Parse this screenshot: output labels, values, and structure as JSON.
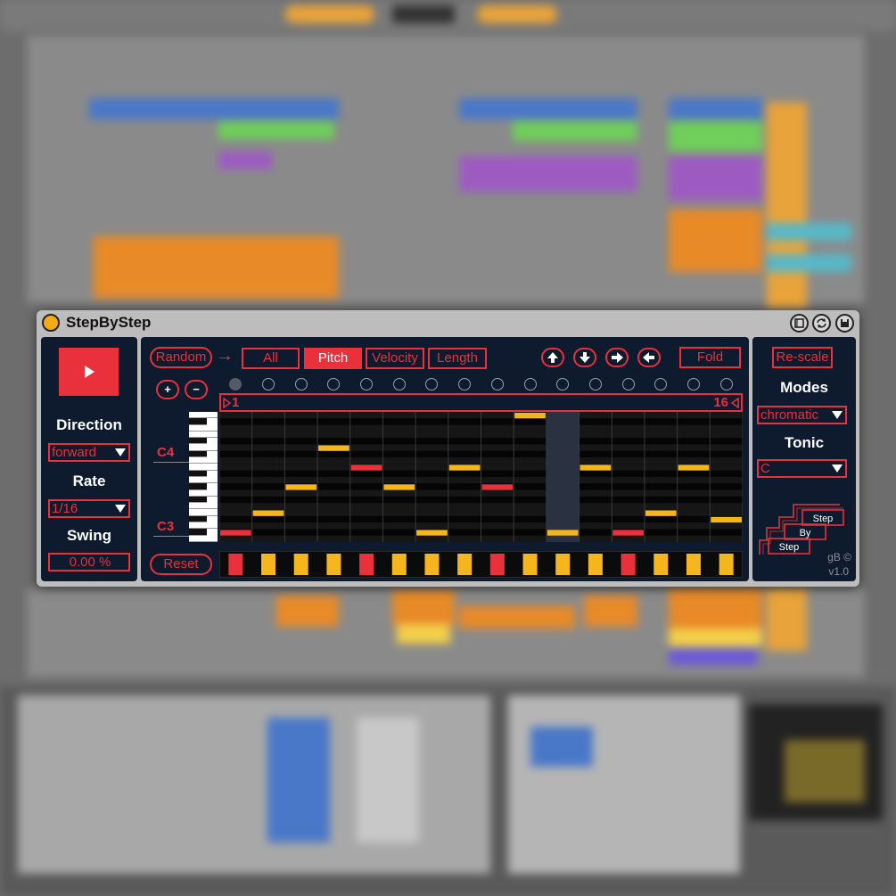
{
  "plugin": {
    "title": "StepByStep",
    "titlebar_icons": [
      "device-icon",
      "refresh-icon",
      "save-icon"
    ]
  },
  "left": {
    "play_icon": "play-icon",
    "direction_label": "Direction",
    "direction_value": "forward",
    "rate_label": "Rate",
    "rate_value": "1/16",
    "swing_label": "Swing",
    "swing_value": "0.00 %"
  },
  "main": {
    "random_label": "Random",
    "arrow": "→",
    "tabs": [
      {
        "label": "All",
        "active": false
      },
      {
        "label": "Pitch",
        "active": true
      },
      {
        "label": "Velocity",
        "active": false
      },
      {
        "label": "Length",
        "active": false
      }
    ],
    "shift_icons": [
      "arrow-up-icon",
      "arrow-down-icon",
      "arrow-right-icon",
      "arrow-left-icon"
    ],
    "fold_label": "Fold",
    "add_label": "+",
    "remove_label": "−",
    "reset_label": "Reset",
    "loop_start": "1",
    "loop_end": "16",
    "key_c4": "C4",
    "key_c3": "C3",
    "step_count": 16,
    "current_step": 1,
    "highlighted_step": 11,
    "pitch_rows": 20,
    "notes": [
      {
        "step": 1,
        "row": 18,
        "color": "red"
      },
      {
        "step": 2,
        "row": 15,
        "color": "yellow"
      },
      {
        "step": 3,
        "row": 11,
        "color": "yellow"
      },
      {
        "step": 4,
        "row": 5,
        "color": "yellow"
      },
      {
        "step": 5,
        "row": 8,
        "color": "red"
      },
      {
        "step": 6,
        "row": 11,
        "color": "yellow"
      },
      {
        "step": 7,
        "row": 18,
        "color": "yellow"
      },
      {
        "step": 8,
        "row": 8,
        "color": "yellow"
      },
      {
        "step": 9,
        "row": 11,
        "color": "red"
      },
      {
        "step": 10,
        "row": 0,
        "color": "yellow"
      },
      {
        "step": 11,
        "row": 18,
        "color": "yellow"
      },
      {
        "step": 12,
        "row": 8,
        "color": "yellow"
      },
      {
        "step": 13,
        "row": 18,
        "color": "red"
      },
      {
        "step": 14,
        "row": 15,
        "color": "yellow"
      },
      {
        "step": 15,
        "row": 8,
        "color": "yellow"
      },
      {
        "step": 16,
        "row": 16,
        "color": "yellow"
      }
    ],
    "velocity_colors": [
      "red",
      "yellow",
      "yellow",
      "yellow",
      "red",
      "yellow",
      "yellow",
      "yellow",
      "red",
      "yellow",
      "yellow",
      "yellow",
      "red",
      "yellow",
      "yellow",
      "yellow"
    ]
  },
  "right": {
    "rescale_label": "Re-scale",
    "modes_label": "Modes",
    "modes_value": "chromatic",
    "tonic_label": "Tonic",
    "tonic_value": "C",
    "logo_words": [
      "Step",
      "By",
      "Step"
    ],
    "credit": "gB ©",
    "version": "v1.0"
  },
  "colors": {
    "accent": "#e8313b",
    "note_yellow": "#f4b61c",
    "panel": "#0e1a2e",
    "power": "#f4a915"
  }
}
